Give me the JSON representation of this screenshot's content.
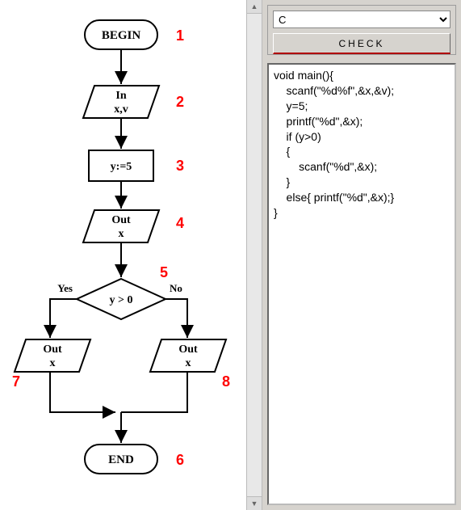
{
  "flow": {
    "begin": "BEGIN",
    "end": "END",
    "input_label": "In",
    "input_vars": "x,v",
    "assign": "y:=5",
    "out_label": "Out",
    "out_var": "x",
    "cond": "y > 0",
    "yes": "Yes",
    "no": "No",
    "numbers": {
      "begin": "1",
      "in": "2",
      "assign": "3",
      "out1": "4",
      "cond": "5",
      "end": "6",
      "outL": "7",
      "outR": "8"
    }
  },
  "chart_data": {
    "type": "flowchart",
    "nodes": [
      {
        "id": 1,
        "type": "terminator",
        "label": "BEGIN"
      },
      {
        "id": 2,
        "type": "io",
        "label": "In x,v"
      },
      {
        "id": 3,
        "type": "process",
        "label": "y:=5"
      },
      {
        "id": 4,
        "type": "io",
        "label": "Out x"
      },
      {
        "id": 5,
        "type": "decision",
        "label": "y > 0"
      },
      {
        "id": 7,
        "type": "io",
        "label": "Out x",
        "branch": "Yes"
      },
      {
        "id": 8,
        "type": "io",
        "label": "Out x",
        "branch": "No"
      },
      {
        "id": 6,
        "type": "terminator",
        "label": "END"
      }
    ],
    "edges": [
      {
        "from": 1,
        "to": 2
      },
      {
        "from": 2,
        "to": 3
      },
      {
        "from": 3,
        "to": 4
      },
      {
        "from": 4,
        "to": 5
      },
      {
        "from": 5,
        "to": 7,
        "label": "Yes"
      },
      {
        "from": 5,
        "to": 8,
        "label": "No"
      },
      {
        "from": 7,
        "to": 6
      },
      {
        "from": 8,
        "to": 6
      }
    ]
  },
  "controls": {
    "language_selected": "C",
    "check_label": "CHECK"
  },
  "code": "void main(){\n    scanf(\"%d%f\",&x,&v);\n    y=5;\n    printf(\"%d\",&x);\n    if (y>0)\n    {\n        scanf(\"%d\",&x);\n    }\n    else{ printf(\"%d\",&x);}\n}"
}
